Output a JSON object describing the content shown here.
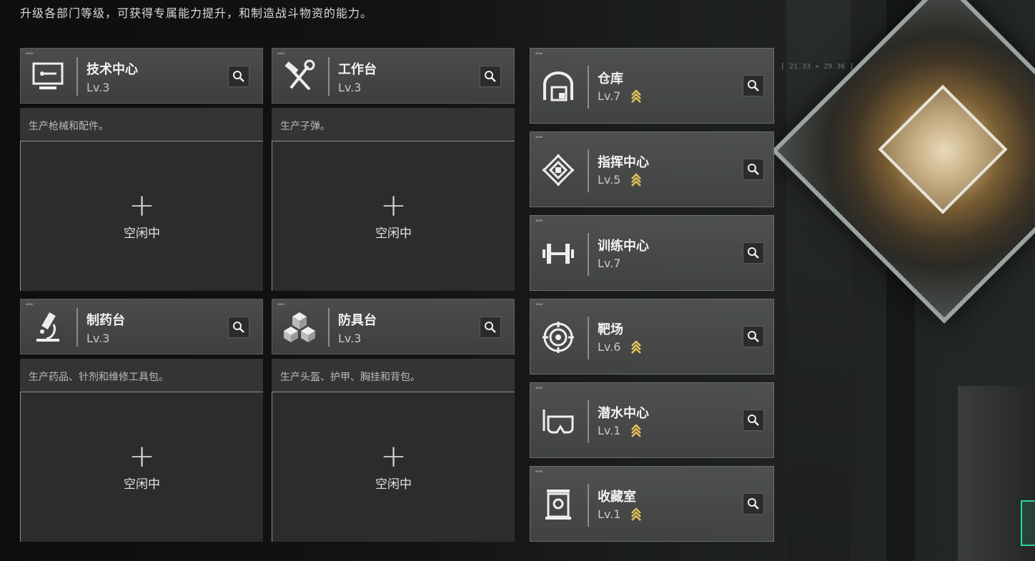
{
  "subtitle": "升级各部门等级，可获得专属能力提升，和制造战斗物资的能力。",
  "background": {
    "coords": "[ 21.33 × 29.36 ]"
  },
  "accent_color": "#e7c25a",
  "departments": [
    {
      "name": "技术中心",
      "level": "Lv.3",
      "icon": "monitor-icon",
      "desc": "生产枪械和配件。",
      "plus": "+",
      "status": "空闲中"
    },
    {
      "name": "工作台",
      "level": "Lv.3",
      "icon": "hammer-wrench-icon",
      "desc": "生产子弹。",
      "plus": "+",
      "status": "空闲中"
    },
    {
      "name": "制药台",
      "level": "Lv.3",
      "icon": "microscope-icon",
      "desc": "生产药品、针剂和维修工具包。",
      "plus": "+",
      "status": "空闲中"
    },
    {
      "name": "防具台",
      "level": "Lv.3",
      "icon": "cubes-icon",
      "desc": "生产头盔、护甲、胸挂和背包。",
      "plus": "+",
      "status": "空闲中"
    }
  ],
  "facilities": [
    {
      "name": "仓库",
      "level": "Lv.7",
      "icon": "warehouse-icon",
      "upgradable": true
    },
    {
      "name": "指挥中心",
      "level": "Lv.5",
      "icon": "command-chip-icon",
      "upgradable": true
    },
    {
      "name": "训练中心",
      "level": "Lv.7",
      "icon": "dumbbell-icon",
      "upgradable": false
    },
    {
      "name": "靶场",
      "level": "Lv.6",
      "icon": "target-icon",
      "upgradable": true
    },
    {
      "name": "潜水中心",
      "level": "Lv.1",
      "icon": "diving-mask-icon",
      "upgradable": true
    },
    {
      "name": "收藏室",
      "level": "Lv.1",
      "icon": "display-case-icon",
      "upgradable": true
    }
  ]
}
